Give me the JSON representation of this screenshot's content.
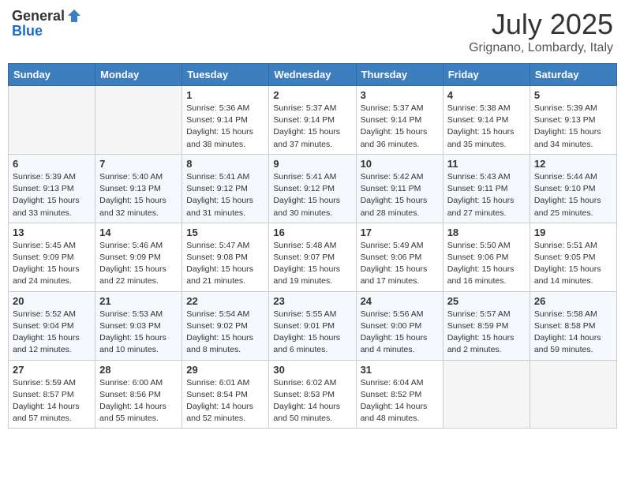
{
  "header": {
    "logo_general": "General",
    "logo_blue": "Blue",
    "month_title": "July 2025",
    "location": "Grignano, Lombardy, Italy"
  },
  "days_of_week": [
    "Sunday",
    "Monday",
    "Tuesday",
    "Wednesday",
    "Thursday",
    "Friday",
    "Saturday"
  ],
  "weeks": [
    [
      {
        "day": "",
        "sunrise": "",
        "sunset": "",
        "daylight": ""
      },
      {
        "day": "",
        "sunrise": "",
        "sunset": "",
        "daylight": ""
      },
      {
        "day": "1",
        "sunrise": "Sunrise: 5:36 AM",
        "sunset": "Sunset: 9:14 PM",
        "daylight": "Daylight: 15 hours and 38 minutes."
      },
      {
        "day": "2",
        "sunrise": "Sunrise: 5:37 AM",
        "sunset": "Sunset: 9:14 PM",
        "daylight": "Daylight: 15 hours and 37 minutes."
      },
      {
        "day": "3",
        "sunrise": "Sunrise: 5:37 AM",
        "sunset": "Sunset: 9:14 PM",
        "daylight": "Daylight: 15 hours and 36 minutes."
      },
      {
        "day": "4",
        "sunrise": "Sunrise: 5:38 AM",
        "sunset": "Sunset: 9:14 PM",
        "daylight": "Daylight: 15 hours and 35 minutes."
      },
      {
        "day": "5",
        "sunrise": "Sunrise: 5:39 AM",
        "sunset": "Sunset: 9:13 PM",
        "daylight": "Daylight: 15 hours and 34 minutes."
      }
    ],
    [
      {
        "day": "6",
        "sunrise": "Sunrise: 5:39 AM",
        "sunset": "Sunset: 9:13 PM",
        "daylight": "Daylight: 15 hours and 33 minutes."
      },
      {
        "day": "7",
        "sunrise": "Sunrise: 5:40 AM",
        "sunset": "Sunset: 9:13 PM",
        "daylight": "Daylight: 15 hours and 32 minutes."
      },
      {
        "day": "8",
        "sunrise": "Sunrise: 5:41 AM",
        "sunset": "Sunset: 9:12 PM",
        "daylight": "Daylight: 15 hours and 31 minutes."
      },
      {
        "day": "9",
        "sunrise": "Sunrise: 5:41 AM",
        "sunset": "Sunset: 9:12 PM",
        "daylight": "Daylight: 15 hours and 30 minutes."
      },
      {
        "day": "10",
        "sunrise": "Sunrise: 5:42 AM",
        "sunset": "Sunset: 9:11 PM",
        "daylight": "Daylight: 15 hours and 28 minutes."
      },
      {
        "day": "11",
        "sunrise": "Sunrise: 5:43 AM",
        "sunset": "Sunset: 9:11 PM",
        "daylight": "Daylight: 15 hours and 27 minutes."
      },
      {
        "day": "12",
        "sunrise": "Sunrise: 5:44 AM",
        "sunset": "Sunset: 9:10 PM",
        "daylight": "Daylight: 15 hours and 25 minutes."
      }
    ],
    [
      {
        "day": "13",
        "sunrise": "Sunrise: 5:45 AM",
        "sunset": "Sunset: 9:09 PM",
        "daylight": "Daylight: 15 hours and 24 minutes."
      },
      {
        "day": "14",
        "sunrise": "Sunrise: 5:46 AM",
        "sunset": "Sunset: 9:09 PM",
        "daylight": "Daylight: 15 hours and 22 minutes."
      },
      {
        "day": "15",
        "sunrise": "Sunrise: 5:47 AM",
        "sunset": "Sunset: 9:08 PM",
        "daylight": "Daylight: 15 hours and 21 minutes."
      },
      {
        "day": "16",
        "sunrise": "Sunrise: 5:48 AM",
        "sunset": "Sunset: 9:07 PM",
        "daylight": "Daylight: 15 hours and 19 minutes."
      },
      {
        "day": "17",
        "sunrise": "Sunrise: 5:49 AM",
        "sunset": "Sunset: 9:06 PM",
        "daylight": "Daylight: 15 hours and 17 minutes."
      },
      {
        "day": "18",
        "sunrise": "Sunrise: 5:50 AM",
        "sunset": "Sunset: 9:06 PM",
        "daylight": "Daylight: 15 hours and 16 minutes."
      },
      {
        "day": "19",
        "sunrise": "Sunrise: 5:51 AM",
        "sunset": "Sunset: 9:05 PM",
        "daylight": "Daylight: 15 hours and 14 minutes."
      }
    ],
    [
      {
        "day": "20",
        "sunrise": "Sunrise: 5:52 AM",
        "sunset": "Sunset: 9:04 PM",
        "daylight": "Daylight: 15 hours and 12 minutes."
      },
      {
        "day": "21",
        "sunrise": "Sunrise: 5:53 AM",
        "sunset": "Sunset: 9:03 PM",
        "daylight": "Daylight: 15 hours and 10 minutes."
      },
      {
        "day": "22",
        "sunrise": "Sunrise: 5:54 AM",
        "sunset": "Sunset: 9:02 PM",
        "daylight": "Daylight: 15 hours and 8 minutes."
      },
      {
        "day": "23",
        "sunrise": "Sunrise: 5:55 AM",
        "sunset": "Sunset: 9:01 PM",
        "daylight": "Daylight: 15 hours and 6 minutes."
      },
      {
        "day": "24",
        "sunrise": "Sunrise: 5:56 AM",
        "sunset": "Sunset: 9:00 PM",
        "daylight": "Daylight: 15 hours and 4 minutes."
      },
      {
        "day": "25",
        "sunrise": "Sunrise: 5:57 AM",
        "sunset": "Sunset: 8:59 PM",
        "daylight": "Daylight: 15 hours and 2 minutes."
      },
      {
        "day": "26",
        "sunrise": "Sunrise: 5:58 AM",
        "sunset": "Sunset: 8:58 PM",
        "daylight": "Daylight: 14 hours and 59 minutes."
      }
    ],
    [
      {
        "day": "27",
        "sunrise": "Sunrise: 5:59 AM",
        "sunset": "Sunset: 8:57 PM",
        "daylight": "Daylight: 14 hours and 57 minutes."
      },
      {
        "day": "28",
        "sunrise": "Sunrise: 6:00 AM",
        "sunset": "Sunset: 8:56 PM",
        "daylight": "Daylight: 14 hours and 55 minutes."
      },
      {
        "day": "29",
        "sunrise": "Sunrise: 6:01 AM",
        "sunset": "Sunset: 8:54 PM",
        "daylight": "Daylight: 14 hours and 52 minutes."
      },
      {
        "day": "30",
        "sunrise": "Sunrise: 6:02 AM",
        "sunset": "Sunset: 8:53 PM",
        "daylight": "Daylight: 14 hours and 50 minutes."
      },
      {
        "day": "31",
        "sunrise": "Sunrise: 6:04 AM",
        "sunset": "Sunset: 8:52 PM",
        "daylight": "Daylight: 14 hours and 48 minutes."
      },
      {
        "day": "",
        "sunrise": "",
        "sunset": "",
        "daylight": ""
      },
      {
        "day": "",
        "sunrise": "",
        "sunset": "",
        "daylight": ""
      }
    ]
  ]
}
